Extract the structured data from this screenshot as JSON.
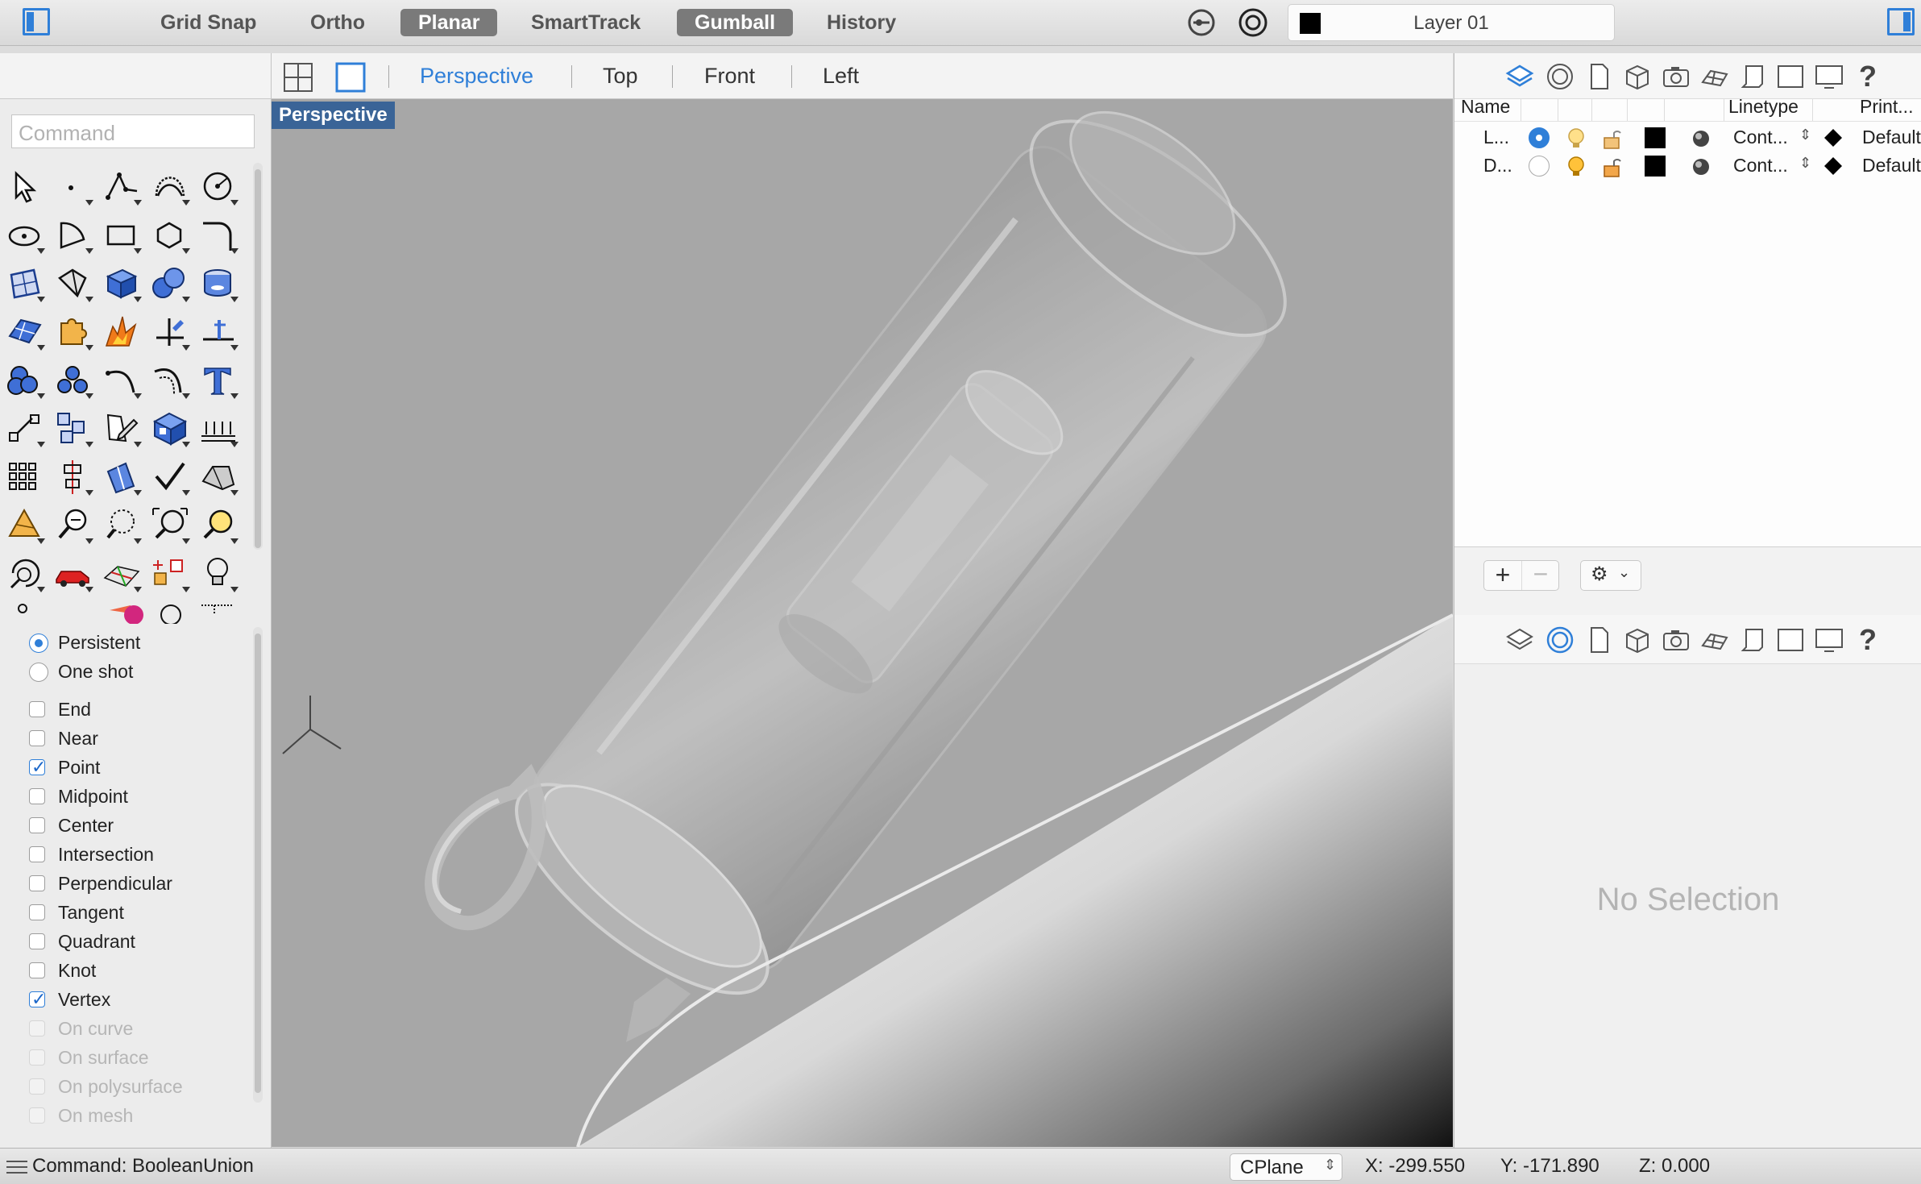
{
  "toolbar": {
    "grid_snap": "Grid Snap",
    "ortho": "Ortho",
    "planar": "Planar",
    "smarttrack": "SmartTrack",
    "gumball": "Gumball",
    "history": "History",
    "current_layer": "Layer 01",
    "layer_color": "#000000"
  },
  "viewport_tabs": {
    "perspective": "Perspective",
    "top": "Top",
    "front": "Front",
    "left": "Left"
  },
  "viewport": {
    "label": "Perspective"
  },
  "command": {
    "placeholder": "Command"
  },
  "osnap": {
    "mode_persistent": "Persistent",
    "mode_oneshot": "One shot",
    "items": [
      {
        "label": "End",
        "checked": false,
        "enabled": true
      },
      {
        "label": "Near",
        "checked": false,
        "enabled": true
      },
      {
        "label": "Point",
        "checked": true,
        "enabled": true
      },
      {
        "label": "Midpoint",
        "checked": false,
        "enabled": true
      },
      {
        "label": "Center",
        "checked": false,
        "enabled": true
      },
      {
        "label": "Intersection",
        "checked": false,
        "enabled": true
      },
      {
        "label": "Perpendicular",
        "checked": false,
        "enabled": true
      },
      {
        "label": "Tangent",
        "checked": false,
        "enabled": true
      },
      {
        "label": "Quadrant",
        "checked": false,
        "enabled": true
      },
      {
        "label": "Knot",
        "checked": false,
        "enabled": true
      },
      {
        "label": "Vertex",
        "checked": true,
        "enabled": true
      },
      {
        "label": "On curve",
        "checked": false,
        "enabled": false
      },
      {
        "label": "On surface",
        "checked": false,
        "enabled": false
      },
      {
        "label": "On polysurface",
        "checked": false,
        "enabled": false
      },
      {
        "label": "On mesh",
        "checked": false,
        "enabled": false
      }
    ]
  },
  "layers": {
    "col_name": "Name",
    "col_linetype": "Linetype",
    "col_print": "Print...",
    "rows": [
      {
        "name": "L...",
        "linetype": "Cont...",
        "print": "Default",
        "current": true
      },
      {
        "name": "D...",
        "linetype": "Cont...",
        "print": "Default",
        "current": false
      }
    ]
  },
  "properties": {
    "empty_text": "No Selection"
  },
  "status": {
    "command": "Command: BooleanUnion",
    "cplane": "CPlane",
    "x": "X: -299.550",
    "y": "Y: -171.890",
    "z": "Z: 0.000"
  },
  "colors": {
    "accent": "#2f7fd8",
    "viewport_bg": "#a7a7a7",
    "viewport_label_bg": "#3a6497"
  }
}
